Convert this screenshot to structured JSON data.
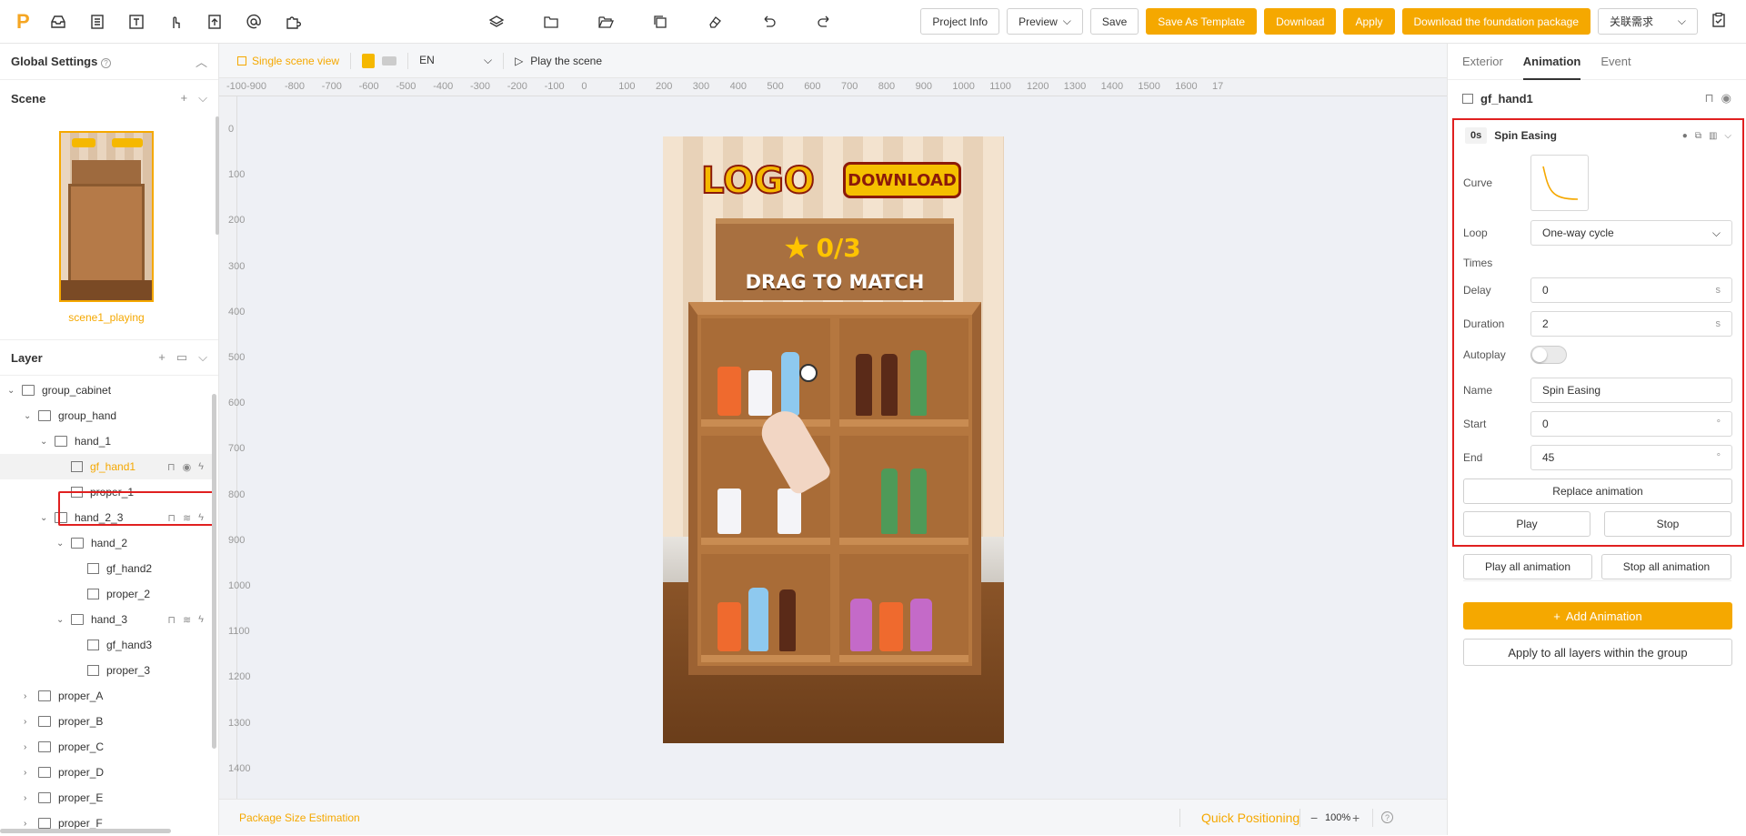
{
  "topbar": {
    "logo_text": "P",
    "buttons": {
      "project_info": "Project Info",
      "preview": "Preview",
      "save": "Save",
      "save_template": "Save As Template",
      "download": "Download",
      "apply": "Apply",
      "download_foundation": "Download the foundation package",
      "linked_requirements": "关联需求"
    }
  },
  "left": {
    "global_settings": "Global Settings",
    "scene_title": "Scene",
    "scene_name": "scene1_playing",
    "layer_title": "Layer",
    "tree": [
      {
        "label": "group_cabinet",
        "depth": 0,
        "type": "folder",
        "open": true
      },
      {
        "label": "group_hand",
        "depth": 1,
        "type": "folder",
        "open": true
      },
      {
        "label": "hand_1",
        "depth": 2,
        "type": "folder",
        "open": true
      },
      {
        "label": "gf_hand1",
        "depth": 3,
        "type": "image",
        "selected": true
      },
      {
        "label": "proper_1",
        "depth": 3,
        "type": "image"
      },
      {
        "label": "hand_2_3",
        "depth": 2,
        "type": "folder",
        "open": true
      },
      {
        "label": "hand_2",
        "depth": 3,
        "type": "folder",
        "open": true
      },
      {
        "label": "gf_hand2",
        "depth": 4,
        "type": "image"
      },
      {
        "label": "proper_2",
        "depth": 4,
        "type": "image"
      },
      {
        "label": "hand_3",
        "depth": 3,
        "type": "folder",
        "open": true
      },
      {
        "label": "gf_hand3",
        "depth": 4,
        "type": "image"
      },
      {
        "label": "proper_3",
        "depth": 4,
        "type": "image"
      },
      {
        "label": "proper_A",
        "depth": 1,
        "type": "folder",
        "open": false
      },
      {
        "label": "proper_B",
        "depth": 1,
        "type": "folder",
        "open": false
      },
      {
        "label": "proper_C",
        "depth": 1,
        "type": "folder",
        "open": false
      },
      {
        "label": "proper_D",
        "depth": 1,
        "type": "folder",
        "open": false
      },
      {
        "label": "proper_E",
        "depth": 1,
        "type": "folder",
        "open": false
      },
      {
        "label": "proper_F",
        "depth": 1,
        "type": "folder",
        "open": false
      }
    ]
  },
  "canvas": {
    "single_scene": "Single scene view",
    "language": "EN",
    "play_scene": "Play the scene",
    "ruler_h": [
      "-100",
      "-900",
      "-800",
      "-700",
      "-600",
      "-500",
      "-400",
      "-300",
      "-200",
      "-100",
      "0",
      "100",
      "200",
      "300",
      "400",
      "500",
      "600",
      "700",
      "800",
      "900",
      "1000",
      "1100",
      "1200",
      "1300",
      "1400",
      "1500",
      "1600",
      "17"
    ],
    "ruler_v": [
      "0",
      "100",
      "200",
      "300",
      "400",
      "500",
      "600",
      "700",
      "800",
      "900",
      "1000",
      "1100",
      "1200",
      "1300",
      "1400"
    ],
    "artboard": {
      "logo": "LOGO",
      "download": "DOWNLOAD",
      "score": "0/3",
      "headline": "DRAG TO MATCH"
    },
    "package_size": "Package Size Estimation",
    "quick_positioning": "Quick Positioning",
    "zoom": "100%"
  },
  "right": {
    "tabs": [
      "Exterior",
      "Animation",
      "Event"
    ],
    "layer_name": "gf_hand1",
    "anim": {
      "time": "0s",
      "title": "Spin Easing",
      "curve_label": "Curve",
      "loop_label": "Loop",
      "loop_value": "One-way cycle",
      "times_label": "Times",
      "delay_label": "Delay",
      "delay_value": "0",
      "delay_unit": "s",
      "duration_label": "Duration",
      "duration_value": "2",
      "duration_unit": "s",
      "autoplay_label": "Autoplay",
      "name_label": "Name",
      "name_value": "Spin Easing",
      "start_label": "Start",
      "start_value": "0",
      "start_unit": "°",
      "end_label": "End",
      "end_value": "45",
      "end_unit": "°",
      "replace": "Replace animation",
      "play": "Play",
      "stop": "Stop"
    },
    "play_all": "Play all animation",
    "stop_all": "Stop all animation",
    "add_animation": "Add Animation",
    "apply_group": "Apply to all layers within the group"
  }
}
